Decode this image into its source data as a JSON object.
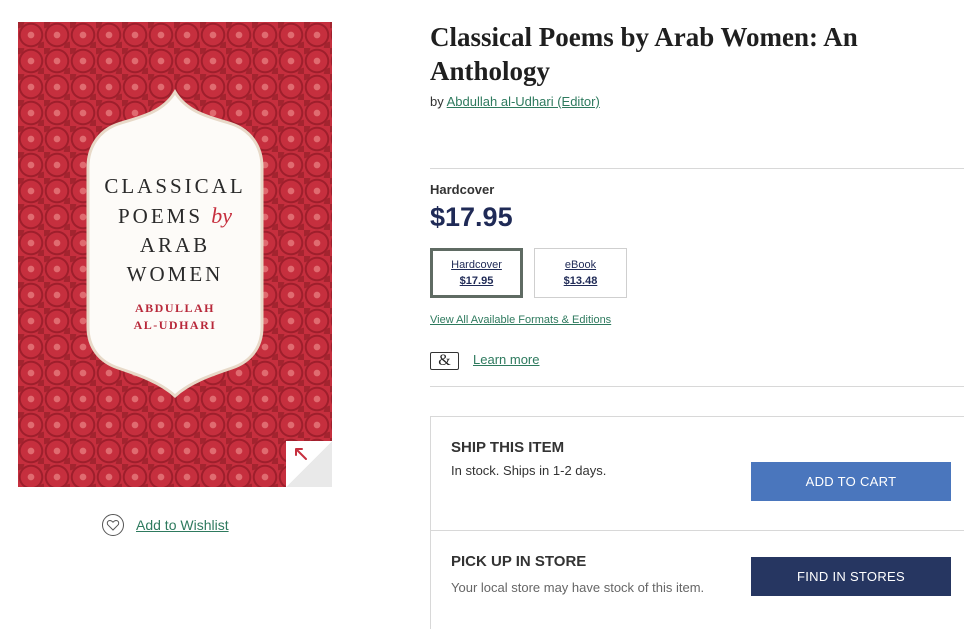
{
  "book": {
    "title": "Classical Poems by Arab Women: An Anthology",
    "by_prefix": "by",
    "author_link": "Abdullah al-Udhari (Editor)"
  },
  "cover": {
    "title_line1": "CLASSICAL",
    "title_line2_a": "POEMS",
    "title_line2_b": "by",
    "title_line3": "ARAB",
    "title_line4": "WOMEN",
    "author_line1": "ABDULLAH",
    "author_line2": "AL-UDHARI",
    "background_color": "#c62f3e"
  },
  "wishlist": {
    "label": "Add to Wishlist",
    "icon": "heart-icon"
  },
  "selected_format": {
    "label": "Hardcover",
    "price": "$17.95"
  },
  "formats": [
    {
      "name": "Hardcover",
      "price": "$17.95",
      "selected": true
    },
    {
      "name": "eBook",
      "price": "$13.48",
      "selected": false
    }
  ],
  "links": {
    "all_formats": "View All Available Formats & Editions",
    "learn_more": "Learn more"
  },
  "membership_icon": {
    "glyph": "&",
    "icon": "ampersand-icon"
  },
  "ship": {
    "heading": "SHIP THIS ITEM",
    "status": "In stock. Ships in 1-2 days.",
    "button": "ADD TO CART"
  },
  "pickup": {
    "heading": "PICK UP IN STORE",
    "text": "Your local store may have stock of this item.",
    "button": "FIND IN STORES"
  },
  "colors": {
    "link_green": "#2e7a5e",
    "add_to_cart_blue": "#4a76bd",
    "find_stores_navy": "#263661",
    "price_navy": "#1f2a56"
  }
}
